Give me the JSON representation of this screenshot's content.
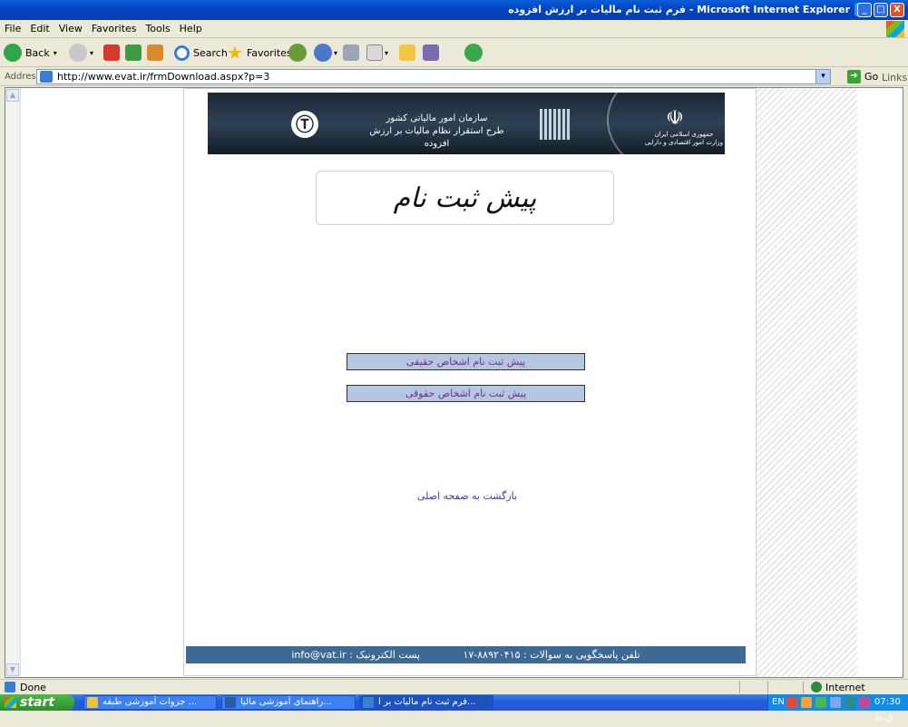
{
  "window": {
    "title": "فرم ثبت نام مالیات بر ارزش افزوده - Microsoft Internet Explorer",
    "buttons": {
      "minimize": "_",
      "maximize": "□",
      "close": "X"
    }
  },
  "menu": [
    "File",
    "Edit",
    "View",
    "Favorites",
    "Tools",
    "Help"
  ],
  "toolbar": {
    "back": "Back",
    "search": "Search",
    "favorites": "Favorites"
  },
  "address": {
    "label": "Address",
    "url": "http://www.evat.ir/frmDownload.aspx?p=3",
    "go": "Go",
    "links": "Links"
  },
  "page": {
    "banner": {
      "org_line1": "سازمان امور مالیاتی کشور",
      "org_line2": "طرح استقرار نظام مالیات بر ارزش افزوده",
      "gov_line1": "جمهوری اسلامی ایران",
      "gov_line2": "وزارت امور اقتصادی و دارایی"
    },
    "heading": "پیش ثبت نام",
    "btn_real": "پیش ثبت نام اشخاص حقیقی",
    "btn_legal": "پیش ثبت نام اشخاص حقوقی",
    "back_link": "بازگشت به صفحه اصلی",
    "footer_phone": "تلفن پاسخگویی به سوالات : ۸۸۹۲۰۴۱۵-۱۷",
    "footer_email": "پست الکترونیک : info@vat.ir"
  },
  "status": {
    "left": "Done",
    "zone": "Internet"
  },
  "taskbar": {
    "start": "start",
    "tasks": [
      "جزوات آموزشی طبقه ...",
      "راهنمای آموزشی مالیا...",
      "فرم ثبت نام مالیات بر ا..."
    ],
    "tray_lang": "EN",
    "clock": "07:30 ق.ظ"
  }
}
